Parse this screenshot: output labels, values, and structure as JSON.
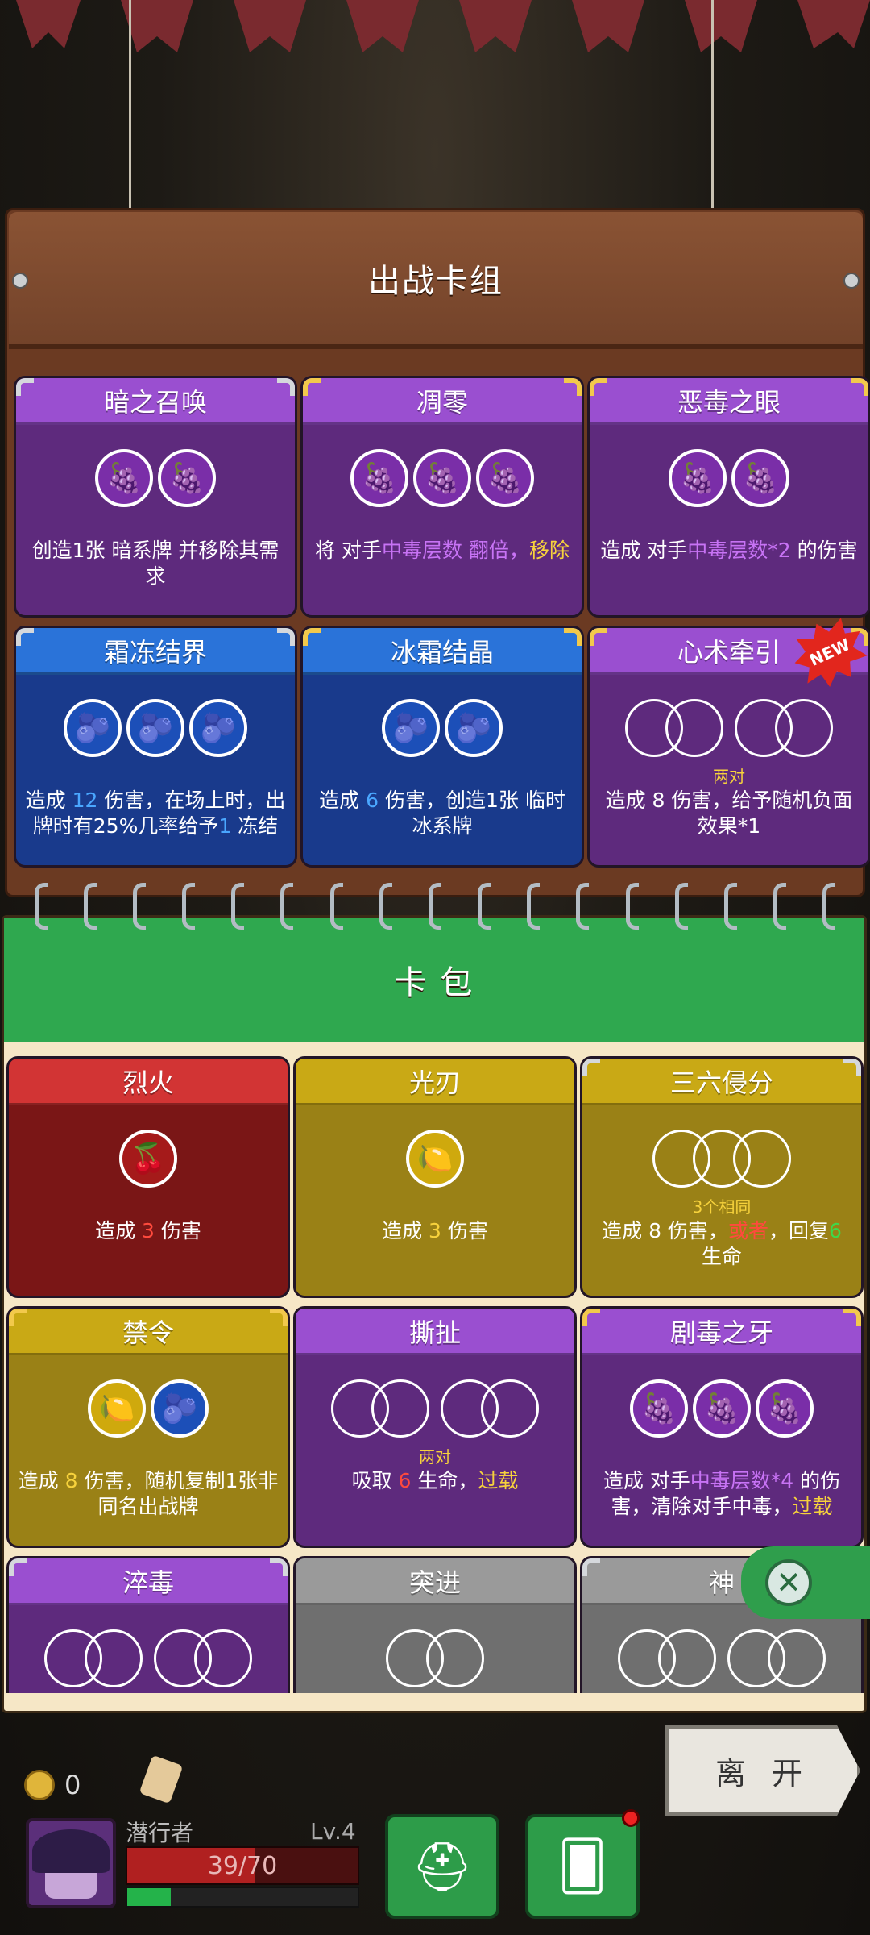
{
  "deck": {
    "title": "出战卡组",
    "cards": [
      {
        "name": "暗之召唤",
        "theme": "purple",
        "corner": "silver",
        "slots": [
          "grape",
          "grape"
        ],
        "requirement": "",
        "desc": [
          "创造1张 ",
          "暗系牌 并移除其需求"
        ]
      },
      {
        "name": "凋零",
        "theme": "purple",
        "corner": "gold",
        "slots": [
          "grape",
          "grape",
          "grape"
        ],
        "requirement": "",
        "desc": [
          "将 对手",
          "中毒层数 翻倍，",
          "移除"
        ]
      },
      {
        "name": "恶毒之眼",
        "theme": "purple",
        "corner": "gold",
        "slots": [
          "grape",
          "grape"
        ],
        "requirement": "",
        "desc": [
          "造成 对手",
          "中毒层数*2",
          " 的伤害"
        ]
      },
      {
        "name": "霜冻结界",
        "theme": "blue",
        "corner": "silver",
        "slots": [
          "blueberry",
          "blueberry",
          "blueberry"
        ],
        "requirement": "",
        "desc": [
          "造成 ",
          "12",
          " 伤害，在场上时，出牌时有25%几率给予",
          "1",
          " 冻结"
        ]
      },
      {
        "name": "冰霜结晶",
        "theme": "blue",
        "corner": "gold",
        "slots": [
          "blueberry",
          "blueberry"
        ],
        "requirement": "",
        "desc": [
          "造成 ",
          "6",
          " 伤害，创造1张 临时",
          "冰系牌"
        ]
      },
      {
        "name": "心术牵引",
        "theme": "purple",
        "corner": "gold",
        "slots": [
          "pair",
          "pair"
        ],
        "requirement": "两对",
        "desc": [
          "造成 ",
          "8 伤害，给予随机负面效果*1"
        ]
      }
    ],
    "new_badge": "NEW"
  },
  "pack": {
    "title": "卡 包",
    "cards": [
      {
        "name": "烈火",
        "theme": "red",
        "corner": "none",
        "slots": [
          "cherry"
        ],
        "requirement": "",
        "desc": [
          "造成 ",
          "3",
          " 伤害"
        ]
      },
      {
        "name": "光刃",
        "theme": "gold",
        "corner": "none",
        "slots": [
          "lemon"
        ],
        "requirement": "",
        "desc": [
          "造成 ",
          "3",
          " 伤害"
        ]
      },
      {
        "name": "三六侵分",
        "theme": "gold",
        "corner": "silver",
        "slots": [
          "triple"
        ],
        "requirement": "3个相同",
        "desc": [
          "造成 ",
          "8 伤害，",
          "或者",
          "，回复",
          "6",
          " 生命"
        ]
      },
      {
        "name": "禁令",
        "theme": "gold",
        "corner": "gold",
        "slots": [
          "lemon",
          "blueberry"
        ],
        "requirement": "",
        "desc": [
          "造成 ",
          "8",
          " 伤害，随机复制1张非同名出战牌"
        ]
      },
      {
        "name": "撕扯",
        "theme": "purple",
        "corner": "none",
        "slots": [
          "pair",
          "pair"
        ],
        "requirement": "两对",
        "desc": [
          "吸取 ",
          "6",
          " 生命，",
          "过载"
        ]
      },
      {
        "name": "剧毒之牙",
        "theme": "purple",
        "corner": "gold",
        "slots": [
          "grape",
          "grape",
          "grape"
        ],
        "requirement": "",
        "desc": [
          "造成 对手",
          "中毒层数*4",
          " 的伤害，清除对手中毒，",
          "过载"
        ]
      },
      {
        "name": "淬毒",
        "theme": "purple",
        "corner": "silver",
        "slots": [
          "pair",
          "pair"
        ],
        "requirement": "两对",
        "desc": [
          "",
          "",
          ""
        ]
      },
      {
        "name": "突进",
        "theme": "gray",
        "corner": "none",
        "slots": [
          "pair"
        ],
        "requirement": "一对",
        "desc": [
          "",
          "",
          ""
        ]
      },
      {
        "name": "神",
        "theme": "gray",
        "corner": "silver",
        "slots": [
          "pair",
          "pair"
        ],
        "requirement": "两对",
        "desc": [
          "",
          "",
          ""
        ]
      }
    ]
  },
  "hud": {
    "gold": "0",
    "player_name": "潜行者",
    "level": "Lv.4",
    "hp": "39/70",
    "hp_fraction": 0.557,
    "xp_fraction": 0.19,
    "leave": "离 开"
  },
  "colors": {
    "purple": "#9a4fd0",
    "blue": "#2a73d9",
    "red": "#d23434",
    "gold": "#c9a915",
    "gray": "#9a9a9a",
    "green": "#2fa84f"
  }
}
